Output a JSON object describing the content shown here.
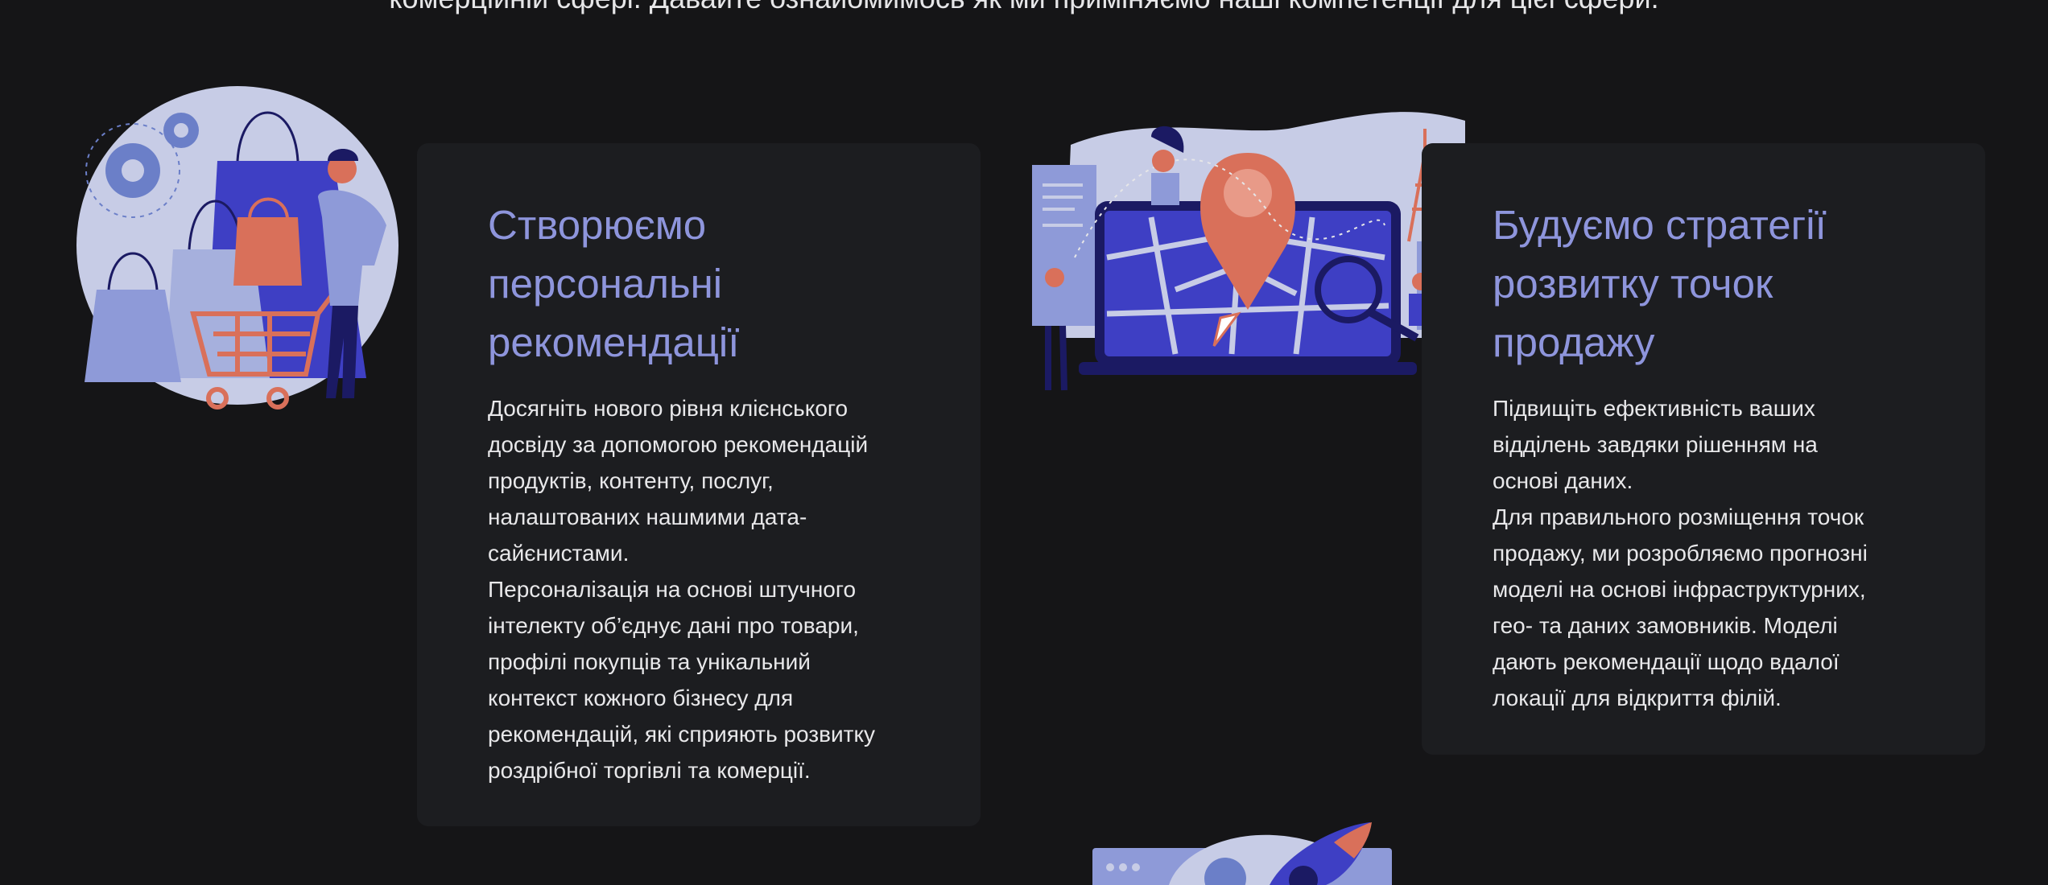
{
  "intro": {
    "text": "комерційній сфері. Давайте ознайомимось як ми приміняємо наші компетенції для цієї сфери."
  },
  "cards": [
    {
      "title": "Створюємо\nперсональні\nрекомендації",
      "body": "Досягніть нового рівня клієнського\nдосвіду за допомогою рекомендацій\nпродуктів, контенту, послуг,\nналаштованих нашмими дата-\nсайєнистами.\nПерсоналізація на основі штучного\nінтелекту об’єднує дані про товари,\nпрофілі покупців та унікальний\nконтекст кожного бізнесу для\nрекомендацій, які сприяють розвитку\nроздрібної торгівлі та комерції.",
      "illustration": "shopping-illustration"
    },
    {
      "title": "Будуємо стратегії\nрозвитку точок\nпродажу",
      "body": "Підвищіть ефективність ваших\nвідділень завдяки рішенням на\nоснові даних.\nДля правильного розміщення точок\nпродажу, ми розробляємо прогнозні\nмоделі на основі інфраструктурних,\nгео- та даних замовників. Моделі\nдають рекомендації щодо вдалої\nлокації для відкриття філій.",
      "illustration": "map-location-illustration"
    }
  ],
  "colors": {
    "background": "#151517",
    "card": "#1c1d20",
    "title": "#8e95dc",
    "accent_blue": "#3e3fc4",
    "accent_light": "#8e9ad8",
    "accent_coral": "#d9705a",
    "navy": "#1b1a63"
  }
}
